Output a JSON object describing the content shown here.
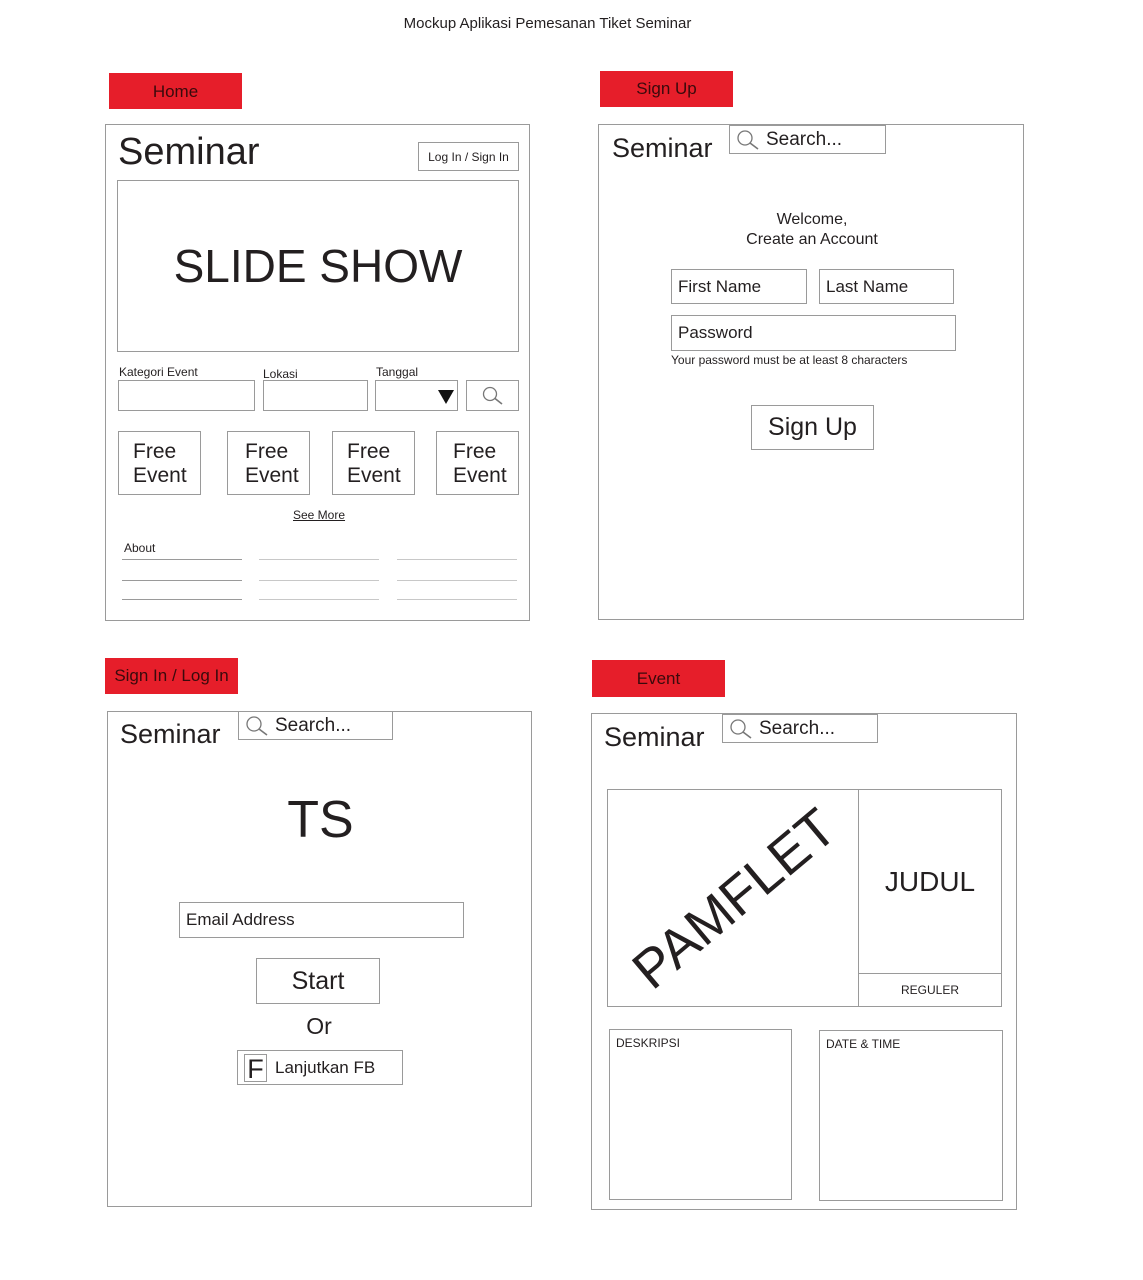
{
  "title": "Mockup Aplikasi Pemesanan Tiket Seminar",
  "home": {
    "tab": "Home",
    "logo": "Seminar",
    "login_button": "Log In / Sign In",
    "slideshow": "SLIDE SHOW",
    "filters": {
      "kategori": "Kategori Event",
      "lokasi": "Lokasi",
      "tanggal": "Tanggal"
    },
    "events": [
      "Free Event",
      "Free Event",
      "Free Event",
      "Free Event"
    ],
    "see_more": "See More",
    "about": "About"
  },
  "signup": {
    "tab": "Sign Up",
    "logo": "Seminar",
    "search_placeholder": "Search...",
    "welcome_line1": "Welcome,",
    "welcome_line2": "Create an Account",
    "first_name": "First Name",
    "last_name": "Last Name",
    "password": "Password",
    "password_hint": "Your password must be at least 8 characters",
    "submit": "Sign Up"
  },
  "signin": {
    "tab": "Sign In / Log In",
    "logo": "Seminar",
    "search_placeholder": "Search...",
    "brand": "TS",
    "email": "Email Address",
    "start": "Start",
    "or": "Or",
    "fb_icon": "F",
    "fb_label": "Lanjutkan FB"
  },
  "event": {
    "tab": "Event",
    "logo": "Seminar",
    "search_placeholder": "Search...",
    "pamflet": "PAMFLET",
    "judul": "JUDUL",
    "reguler": "REGULER",
    "deskripsi": "DESKRIPSI",
    "date_time": "DATE & TIME"
  }
}
